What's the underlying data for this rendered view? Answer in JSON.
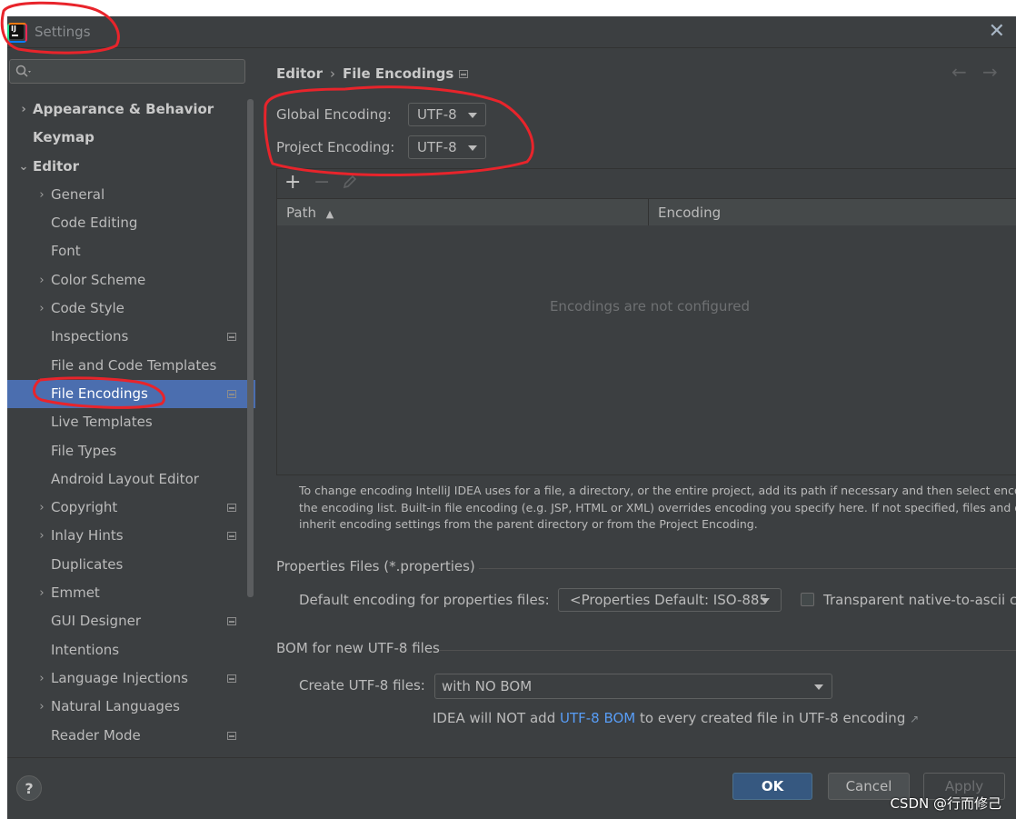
{
  "window": {
    "title": "Settings"
  },
  "sidebar": {
    "items": [
      {
        "label": "Appearance & Behavior",
        "indent": 0,
        "arrow": "›",
        "bold": true,
        "project": false
      },
      {
        "label": "Keymap",
        "indent": 0,
        "arrow": "",
        "bold": true,
        "project": false
      },
      {
        "label": "Editor",
        "indent": 0,
        "arrow": "⌄",
        "bold": true,
        "project": false
      },
      {
        "label": "General",
        "indent": 1,
        "arrow": "›",
        "bold": false,
        "project": false
      },
      {
        "label": "Code Editing",
        "indent": 1,
        "arrow": "",
        "bold": false,
        "project": false
      },
      {
        "label": "Font",
        "indent": 1,
        "arrow": "",
        "bold": false,
        "project": false
      },
      {
        "label": "Color Scheme",
        "indent": 1,
        "arrow": "›",
        "bold": false,
        "project": false
      },
      {
        "label": "Code Style",
        "indent": 1,
        "arrow": "›",
        "bold": false,
        "project": false
      },
      {
        "label": "Inspections",
        "indent": 1,
        "arrow": "",
        "bold": false,
        "project": true
      },
      {
        "label": "File and Code Templates",
        "indent": 1,
        "arrow": "",
        "bold": false,
        "project": false
      },
      {
        "label": "File Encodings",
        "indent": 1,
        "arrow": "",
        "bold": false,
        "project": true,
        "selected": true
      },
      {
        "label": "Live Templates",
        "indent": 1,
        "arrow": "",
        "bold": false,
        "project": false
      },
      {
        "label": "File Types",
        "indent": 1,
        "arrow": "",
        "bold": false,
        "project": false
      },
      {
        "label": "Android Layout Editor",
        "indent": 1,
        "arrow": "",
        "bold": false,
        "project": false
      },
      {
        "label": "Copyright",
        "indent": 1,
        "arrow": "›",
        "bold": false,
        "project": true
      },
      {
        "label": "Inlay Hints",
        "indent": 1,
        "arrow": "›",
        "bold": false,
        "project": true
      },
      {
        "label": "Duplicates",
        "indent": 1,
        "arrow": "",
        "bold": false,
        "project": false
      },
      {
        "label": "Emmet",
        "indent": 1,
        "arrow": "›",
        "bold": false,
        "project": false
      },
      {
        "label": "GUI Designer",
        "indent": 1,
        "arrow": "",
        "bold": false,
        "project": true
      },
      {
        "label": "Intentions",
        "indent": 1,
        "arrow": "",
        "bold": false,
        "project": false
      },
      {
        "label": "Language Injections",
        "indent": 1,
        "arrow": "›",
        "bold": false,
        "project": true
      },
      {
        "label": "Natural Languages",
        "indent": 1,
        "arrow": "›",
        "bold": false,
        "project": false
      },
      {
        "label": "Reader Mode",
        "indent": 1,
        "arrow": "",
        "bold": false,
        "project": true
      }
    ]
  },
  "breadcrumb": {
    "parent": "Editor",
    "separator": "›",
    "current": "File Encodings"
  },
  "nav": {
    "back": "←",
    "forward": "→"
  },
  "encoding": {
    "global_label": "Global Encoding:",
    "global_value": "UTF-8",
    "project_label": "Project Encoding:",
    "project_value": "UTF-8"
  },
  "table": {
    "add": "+",
    "remove": "−",
    "col_path": "Path",
    "sort_icon": "▲",
    "col_encoding": "Encoding",
    "empty_text": "Encodings are not configured"
  },
  "help_text": {
    "line1": "To change encoding IntelliJ IDEA uses for a file, a directory, or the entire project, add its path if necessary and then select encodi",
    "line2": "the encoding list. Built-in file encoding (e.g. JSP, HTML or XML) overrides encoding you specify here. If not specified, files and dir",
    "line3": "inherit encoding settings from the parent directory or from the Project Encoding."
  },
  "properties": {
    "section_title": "Properties Files (*.properties)",
    "default_label": "Default encoding for properties files:",
    "default_value": "<Properties Default: ISO-885",
    "transparent_label": "Transparent native-to-ascii co"
  },
  "bom": {
    "section_title": "BOM for new UTF-8 files",
    "create_label": "Create UTF-8 files:",
    "create_value": "with NO BOM",
    "note_before": "IDEA will NOT add ",
    "note_link": "UTF-8 BOM",
    "note_after": " to every created file in UTF-8 encoding",
    "ext_icon": "↗"
  },
  "footer": {
    "help": "?",
    "ok": "OK",
    "cancel": "Cancel",
    "apply": "Apply"
  },
  "watermark": "CSDN @行而修己",
  "colors": {
    "background": "#3c3f41",
    "selection": "#4b6eaf",
    "ok_button": "#365880",
    "link": "#589df6",
    "annotation": "#e8242b"
  }
}
